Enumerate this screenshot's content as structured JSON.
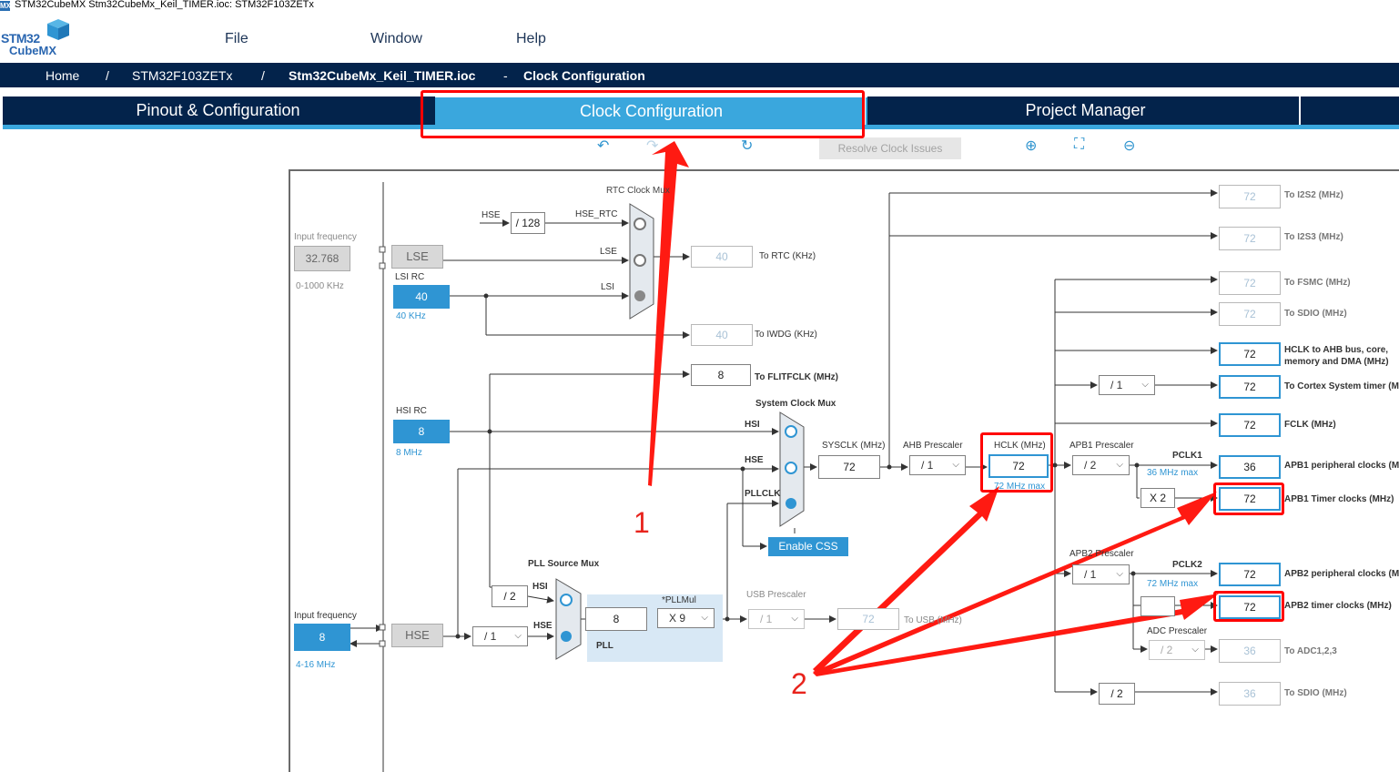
{
  "window": {
    "title": "STM32CubeMX Stm32CubeMx_Keil_TIMER.ioc: STM32F103ZETx"
  },
  "logo": {
    "line1": "STM32",
    "line2": "CubeMX"
  },
  "menu": [
    "File",
    "Window",
    "Help"
  ],
  "breadcrumb": [
    "Home",
    "/",
    "STM32F103ZETx",
    "/",
    "Stm32CubeMx_Keil_TIMER.ioc",
    "-",
    "Clock Configuration"
  ],
  "tabs": [
    "Pinout & Configuration",
    "Clock Configuration",
    "Project Manager"
  ],
  "toolbar": {
    "resolve": "Resolve Clock Issues"
  },
  "clock": {
    "input_freq_label": "Input frequency",
    "lse_freq": "32.768",
    "lse_range": "0-1000 KHz",
    "lse": "LSE",
    "lsi_rc": "LSI RC",
    "lsi": "40",
    "lsi_unit": "40 KHz",
    "hsi_rc": "HSI RC",
    "hsi": "8",
    "hsi_unit": "8 MHz",
    "hse_freq": "8",
    "hse_range": "4-16 MHz",
    "hse": "HSE",
    "rtc_mux": "RTC Clock Mux",
    "hse_small": "HSE",
    "div128": "/ 128",
    "hse_rtc": "HSE_RTC",
    "lse_small": "LSE",
    "lsi_small": "LSI",
    "rtc_out": "40",
    "rtc_label": "To RTC (KHz)",
    "iwdg_out": "40",
    "iwdg_label": "To IWDG (KHz)",
    "flit_out": "8",
    "flit_label": "To FLITFCLK (MHz)",
    "sys_mux": "System Clock Mux",
    "hsi_in": "HSI",
    "hse_in": "HSE",
    "pllclk_in": "PLLCLK",
    "enable_css": "Enable CSS",
    "sysclk_label": "SYSCLK (MHz)",
    "sysclk": "72",
    "ahb_label": "AHB Prescaler",
    "ahb": "/ 1",
    "hclk_label": "HCLK (MHz)",
    "hclk": "72",
    "hclk_max": "72 MHz max",
    "apb1_label": "APB1 Prescaler",
    "apb1": "/ 2",
    "pclk1": "PCLK1",
    "pclk1_max": "36 MHz max",
    "x2": "X 2",
    "apb2_label": "APB2 Prescaler",
    "apb2": "/ 1",
    "pclk2": "PCLK2",
    "pclk2_max": "72 MHz max",
    "adc_label": "ADC Prescaler",
    "adc": "/ 2",
    "cortex_div": "/ 1",
    "sdio_div": "/ 2",
    "pll_src_mux": "PLL Source Mux",
    "div2": "/ 2",
    "hsi_pll": "HSI",
    "hse_pll": "HSE",
    "hse_prediv": "/ 1",
    "pll_in": "8",
    "pllmul_label": "*PLLMul",
    "pllmul": "X 9",
    "pll": "PLL",
    "usb_label": "USB Prescaler",
    "usb": "/ 1",
    "usb_out": "72",
    "usb_to": "To USB (MHz)",
    "outputs": [
      {
        "value": "72",
        "label": "To I2S2 (MHz)"
      },
      {
        "value": "72",
        "label": "To I2S3 (MHz)"
      },
      {
        "value": "72",
        "label": "To FSMC (MHz)"
      },
      {
        "value": "72",
        "label": "To SDIO (MHz)"
      },
      {
        "value": "72",
        "label": "HCLK to AHB bus, core,"
      },
      {
        "value": "72",
        "label": "To Cortex System timer (M"
      },
      {
        "value": "72",
        "label": "FCLK (MHz)"
      },
      {
        "value": "36",
        "label": "APB1 peripheral clocks (M"
      },
      {
        "value": "72",
        "label": "APB1 Timer clocks (MHz)"
      },
      {
        "value": "72",
        "label": "APB2 peripheral clocks (M"
      },
      {
        "value": "72",
        "label": "APB2 timer clocks (MHz)"
      },
      {
        "value": "36",
        "label": "To ADC1,2,3"
      },
      {
        "value": "36",
        "label": "To SDIO (MHz)"
      }
    ],
    "hclk_label2": "memory and DMA (MHz)"
  },
  "annotations": {
    "one": "1",
    "two": "2"
  }
}
